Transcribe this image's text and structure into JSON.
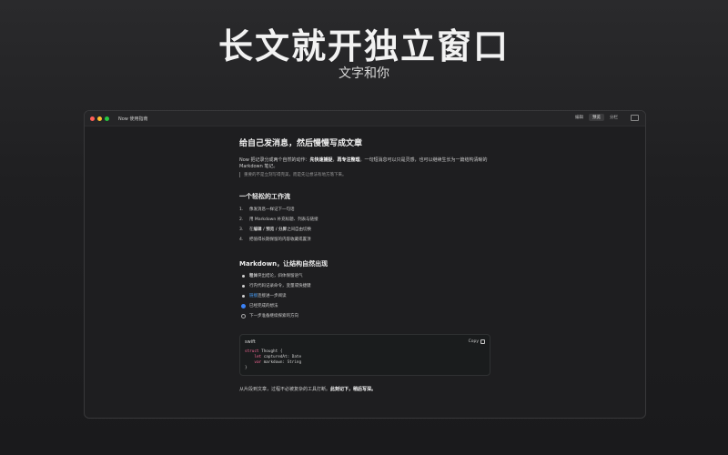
{
  "hero": {
    "title": "长文就开独立窗口",
    "subtitle": "文字和你"
  },
  "window": {
    "title": "Now 使用指南",
    "modes": [
      "编辑",
      "预览",
      "分栏"
    ],
    "active_mode": "预览"
  },
  "doc": {
    "h1": "给自己发消息，然后慢慢写成文章",
    "intro": {
      "a": "Now 把记录分成两个自然的动作：",
      "b1": "先快速捕捉",
      "c": "，",
      "b2": "再专注整理",
      "d": "。一句短消息可以只是灵感，也可以继续生长为一篇结构清晰的 Markdown 笔记。"
    },
    "quote": "重要的不是立刻写得完美，而是先让想法有地方落下来。",
    "h2_workflow": "一个轻松的工作流",
    "workflow": [
      {
        "n": "1.",
        "text": "像发消息一样记下一句话"
      },
      {
        "n": "2.",
        "text": "用 Markdown 补充标题、列表与链接"
      },
      {
        "n": "3.",
        "pre": "在 ",
        "bold": "编辑 / 预览 / 分屏",
        "post": " 之间自由切换"
      },
      {
        "n": "4.",
        "text": "把值得长期保留的内容收藏或置顶"
      }
    ],
    "h2_markdown": "Markdown，让结构自然出现",
    "bullets": [
      {
        "bold": "粗体",
        "text": "突出结论，斜体保留语气"
      },
      {
        "text": "行内代码记录命令，变量或快捷键"
      },
      {
        "link": "链接",
        "text": "连接进一步阅读"
      }
    ],
    "tasks": [
      {
        "checked": true,
        "text": "已经完成的想法"
      },
      {
        "checked": false,
        "text": "下一步准备继续探索的方向"
      }
    ],
    "code": {
      "lang": "swift",
      "copy": "Copy",
      "lines": [
        {
          "kw": "struct",
          "rest": " Thought {"
        },
        {
          "indent": "    ",
          "kw": "let",
          "rest": " capturedAt: Date"
        },
        {
          "indent": "    ",
          "kw": "var",
          "rest": " markdown: String"
        },
        {
          "rest": "}"
        }
      ]
    },
    "final": {
      "a": "从片段到文章，过程不必被复杂的工具打断。",
      "b": "此刻记下，稍后写深。"
    }
  },
  "icons": [
    "close-icon",
    "minimize-icon",
    "zoom-icon",
    "sidebar-toggle-icon",
    "copy-icon"
  ],
  "colors": {
    "accent": "#3b82f6",
    "link": "#4aa3ff",
    "keyword": "#ff6b9a"
  }
}
